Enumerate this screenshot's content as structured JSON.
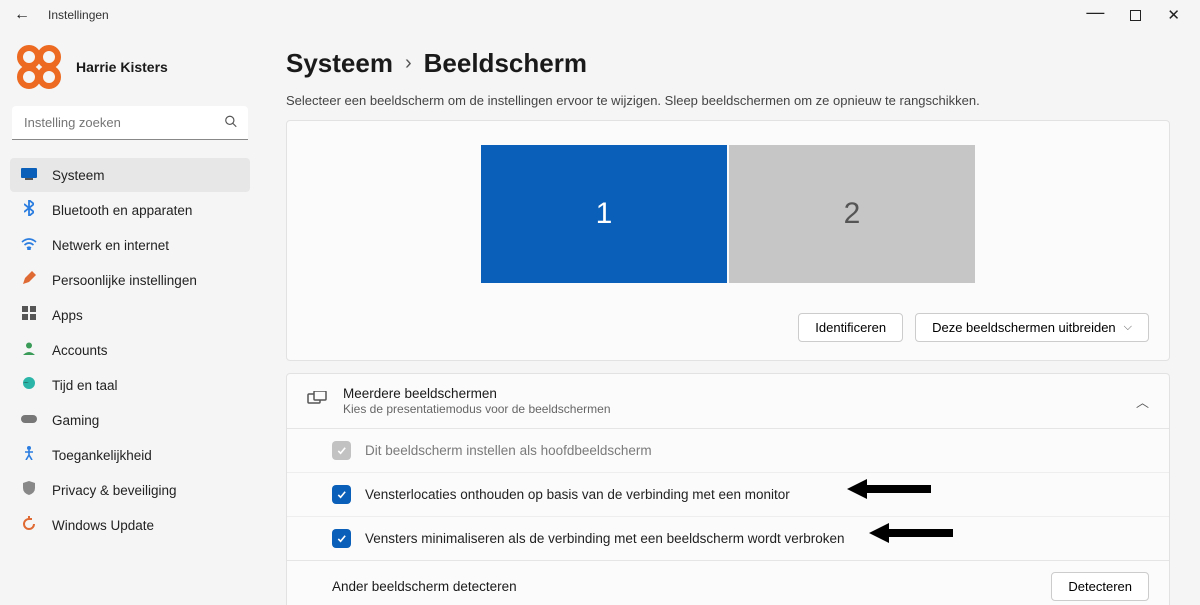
{
  "window": {
    "title": "Instellingen"
  },
  "user": {
    "name": "Harrie Kisters"
  },
  "search": {
    "placeholder": "Instelling zoeken"
  },
  "nav": {
    "items": [
      {
        "label": "Systeem",
        "active": true
      },
      {
        "label": "Bluetooth en apparaten",
        "active": false
      },
      {
        "label": "Netwerk en internet",
        "active": false
      },
      {
        "label": "Persoonlijke instellingen",
        "active": false
      },
      {
        "label": "Apps",
        "active": false
      },
      {
        "label": "Accounts",
        "active": false
      },
      {
        "label": "Tijd en taal",
        "active": false
      },
      {
        "label": "Gaming",
        "active": false
      },
      {
        "label": "Toegankelijkheid",
        "active": false
      },
      {
        "label": "Privacy & beveiliging",
        "active": false
      },
      {
        "label": "Windows Update",
        "active": false
      }
    ]
  },
  "breadcrumb": {
    "parent": "Systeem",
    "page": "Beeldscherm"
  },
  "subtitle": "Selecteer een beeldscherm om de instellingen ervoor te wijzigen. Sleep beeldschermen om ze opnieuw te rangschikken.",
  "monitors": {
    "primary": {
      "label": "1"
    },
    "secondary": {
      "label": "2"
    }
  },
  "buttons": {
    "identify": "Identificeren",
    "extend": "Deze beeldschermen uitbreiden",
    "detect": "Detecteren"
  },
  "multi": {
    "title": "Meerdere beeldschermen",
    "subtitle": "Kies de presentatiemodus voor de beeldschermen",
    "opt_main": "Dit beeldscherm instellen als hoofdbeeldscherm",
    "opt_remember": "Vensterlocaties onthouden op basis van de verbinding met een monitor",
    "opt_minimize": "Vensters minimaliseren als de verbinding met een beeldscherm wordt verbroken",
    "detect_label": "Ander beeldscherm detecteren"
  }
}
